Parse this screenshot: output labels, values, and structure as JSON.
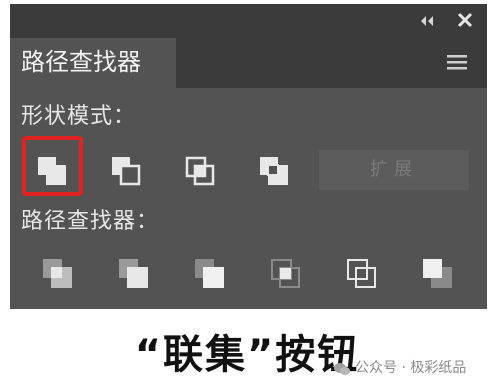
{
  "panel": {
    "tab_title": "路径查找器",
    "shape_modes": {
      "label": "形状模式：",
      "expand_label": "扩展",
      "buttons": [
        {
          "name": "unite",
          "selected": true
        },
        {
          "name": "minus-front",
          "selected": false
        },
        {
          "name": "intersect",
          "selected": false
        },
        {
          "name": "exclude",
          "selected": false
        }
      ]
    },
    "pathfinders": {
      "label": "路径查找器：",
      "buttons": [
        "divide",
        "trim",
        "merge",
        "crop",
        "outline",
        "minus-back"
      ]
    },
    "icons": [
      "collapse-icon",
      "close-icon",
      "menu-icon"
    ]
  },
  "caption": "“联集”按钮",
  "watermark": "公众号 · 极彩纸品",
  "colors": {
    "panel_bg": "#535353",
    "header_bg": "#3b3b3b",
    "highlight": "#e02222",
    "text": "#e6e6e6"
  }
}
